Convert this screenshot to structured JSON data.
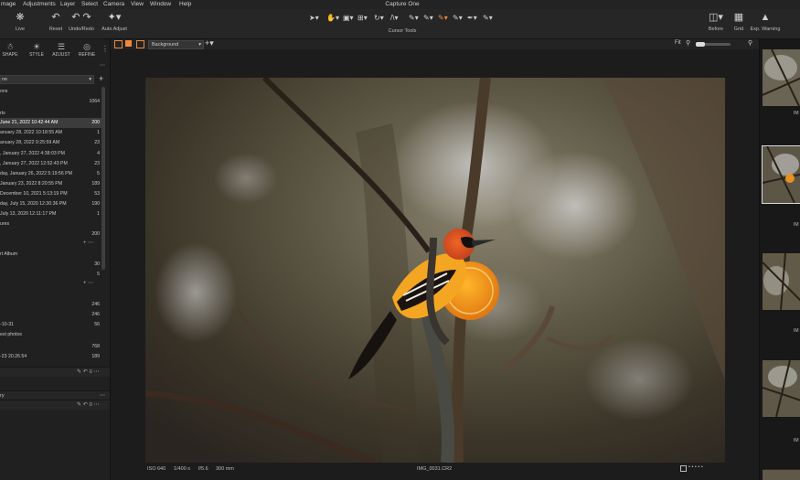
{
  "menubar": {
    "items": [
      "mage",
      "Adjustments",
      "Layer",
      "Select",
      "Camera",
      "View",
      "Window",
      "Help"
    ],
    "app_title": "Capture One"
  },
  "toolbar": {
    "live": "Live",
    "reset": "Reset",
    "undo_redo": "Undo/Redo",
    "auto_adjust": "Auto Adjust",
    "cursor_tools": "Cursor Tools",
    "before": "Before",
    "grid": "Grid",
    "exp_warning": "Exp. Warning"
  },
  "panel_tabs": [
    "SHAPE",
    "STYLE",
    "ADJUST",
    "REFINE"
  ],
  "collection_select": "ne",
  "collections": [
    {
      "label": "ons",
      "count": ""
    },
    {
      "label": "",
      "count": "1064"
    },
    {
      "label": "rts",
      "count": ""
    },
    {
      "label": "June 21, 2022 10:42:44 AM",
      "count": "200"
    },
    {
      "label": "anuary 28, 2022 10:18:55 AM",
      "count": "1"
    },
    {
      "label": "anuary 28, 2022 9:25:59 AM",
      "count": "23"
    },
    {
      "label": ", January 27, 2022 4:38:03 PM",
      "count": "4"
    },
    {
      "label": ", January 27, 2022 12:52:43 PM",
      "count": "23"
    },
    {
      "label": "day, January 26, 2022 5:19:56 PM",
      "count": "5"
    },
    {
      "label": "January 23, 2022 8:20:55 PM",
      "count": "189"
    },
    {
      "label": "December 10, 2021 5:13:19 PM",
      "count": "53"
    },
    {
      "label": "day, July 15, 2020 12:30:36 PM",
      "count": "190"
    },
    {
      "label": "July 13, 2020 12:11:17 PM",
      "count": "1"
    },
    {
      "label": "ures",
      "count": ""
    },
    {
      "label": "",
      "count": "200"
    }
  ],
  "albums": [
    {
      "label": "rt Album",
      "count": ""
    },
    {
      "label": "",
      "count": "30"
    },
    {
      "label": "",
      "count": "5"
    }
  ],
  "catalog_rows": [
    {
      "label": "",
      "count": "246"
    },
    {
      "label": "",
      "count": "246"
    },
    {
      "label": "-10-31",
      "count": "56"
    },
    {
      "label": "est photos",
      "count": ""
    },
    {
      "label": "",
      "count": "768"
    },
    {
      "label": "-23 20.26.54",
      "count": "189"
    }
  ],
  "sections": [
    "",
    "ry",
    ""
  ],
  "viewer": {
    "variant": "Background",
    "zoom": "Fit",
    "iso": "ISO 640",
    "shutter": "1/400 s",
    "aperture": "f/5.6",
    "focal": "300 mm",
    "filename": "IMG_0031.CR2"
  },
  "filmstrip": [
    "IM",
    "IM",
    "IM",
    "IM"
  ],
  "colors": {
    "accent": "#ee8a3a",
    "panel": "#202020",
    "selected_row": "#3c3c3c"
  }
}
